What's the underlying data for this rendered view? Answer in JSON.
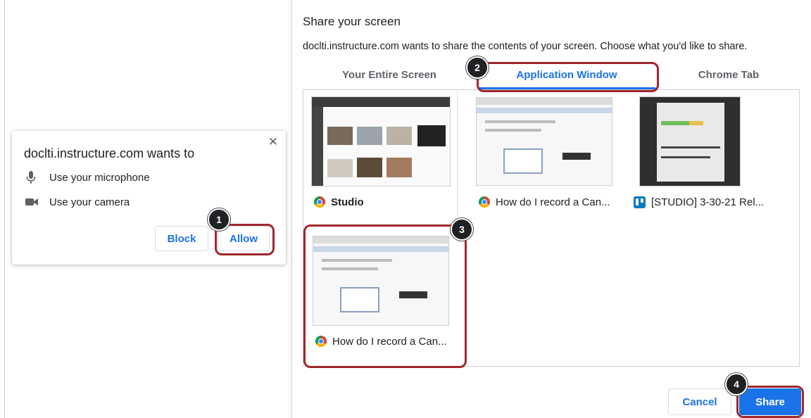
{
  "permission_popup": {
    "title": "doclti.instructure.com wants to",
    "close_glyph": "✕",
    "items": [
      {
        "icon": "microphone-icon",
        "label": "Use your microphone"
      },
      {
        "icon": "camera-icon",
        "label": "Use your camera"
      }
    ],
    "block_label": "Block",
    "allow_label": "Allow"
  },
  "share_dialog": {
    "title": "Share your screen",
    "description": "doclti.instructure.com wants to share the contents of your screen. Choose what you'd like to share.",
    "tabs": [
      {
        "label": "Your Entire Screen",
        "active": false
      },
      {
        "label": "Application Window",
        "active": true
      },
      {
        "label": "Chrome Tab",
        "active": false
      }
    ],
    "windows": [
      {
        "icon": "chrome-icon",
        "label": "Studio"
      },
      {
        "icon": "chrome-icon",
        "label": "How do I record a Can..."
      },
      {
        "icon": "trello-icon",
        "label": "[STUDIO] 3-30-21 Rel..."
      },
      {
        "icon": "chrome-icon",
        "label": "How do I record a Can..."
      }
    ],
    "cancel_label": "Cancel",
    "share_label": "Share"
  },
  "callouts": [
    {
      "step": "1"
    },
    {
      "step": "2"
    },
    {
      "step": "3"
    },
    {
      "step": "4"
    }
  ],
  "colors": {
    "accent": "#1a73e8",
    "callout_border": "#a0282d",
    "badge": "#202124"
  }
}
